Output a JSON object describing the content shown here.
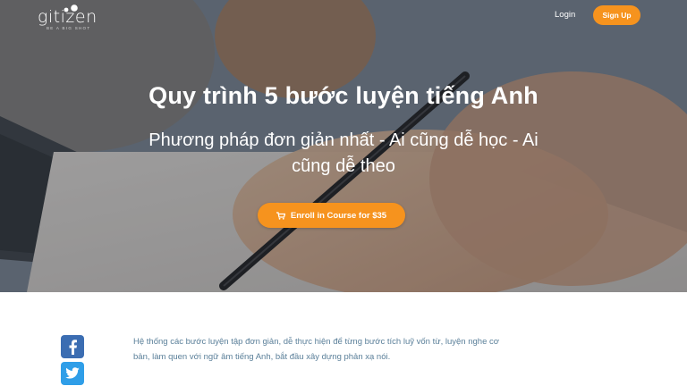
{
  "header": {
    "logo_text": "gitizen",
    "logo_tagline": "BE A BIG SHOT",
    "login_label": "Login",
    "signup_label": "Sign Up"
  },
  "hero": {
    "title": "Quy trình 5 bước luyện tiếng Anh",
    "subtitle": "Phương pháp đơn giản nhất - Ai cũng dễ học - Ai cũng dễ theo",
    "enroll_label": "Enroll in Course for $35",
    "background_image": "hand-writing-with-pen"
  },
  "social": {
    "icons": [
      "facebook-icon",
      "twitter-icon"
    ]
  },
  "content": {
    "description": "Hệ thống các bước luyện tập đơn giản, dễ thực hiện để từng bước tích luỹ vốn từ, luyện nghe cơ bản, làm quen với ngữ âm tiếng Anh, bắt đầu xây dựng phản xạ nói."
  },
  "colors": {
    "accent": "#f6931e",
    "facebook": "#3b6db2",
    "twitter": "#2f9ee8",
    "body_text": "#5a7f99"
  }
}
